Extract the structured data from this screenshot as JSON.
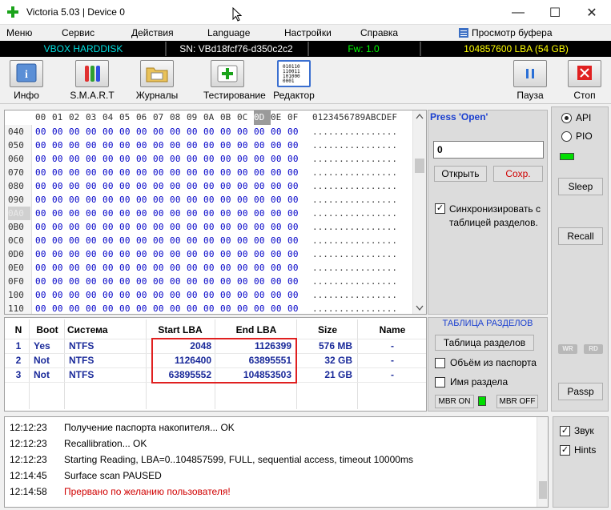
{
  "window": {
    "title": "Victoria 5.03 | Device 0",
    "minimize": "—",
    "maximize": "☐",
    "close": "✕"
  },
  "menu": {
    "items": [
      "Меню",
      "Сервис",
      "Действия",
      "Language",
      "Настройки",
      "Справка"
    ],
    "buffer_view": "Просмотр буфера"
  },
  "drive": {
    "model": "VBOX HARDDISK",
    "serial": "SN: VBd18fcf76-d350c2c2",
    "firmware": "Fw: 1.0",
    "capacity": "104857600 LBA (54 GB)",
    "colors": {
      "model": "#00e0e0",
      "serial": "#ffffff",
      "firmware": "#00ff00",
      "capacity": "#ffff00"
    }
  },
  "toolbar": {
    "info": "Инфо",
    "smart": "S.M.A.R.T",
    "logs": "Журналы",
    "testing": "Тестирование",
    "editor": "Редактор",
    "pause": "Пауза",
    "stop": "Стоп",
    "editor_icon_text": [
      "010110",
      "110011",
      "101000",
      "0001"
    ]
  },
  "hex": {
    "columns": [
      "00",
      "01",
      "02",
      "03",
      "04",
      "05",
      "06",
      "07",
      "08",
      "09",
      "0A",
      "0B",
      "0C",
      "0D",
      "0E",
      "0F"
    ],
    "selected_column": "0D",
    "ascii_header": "0123456789ABCDEF",
    "rows": [
      "040",
      "050",
      "060",
      "070",
      "080",
      "090",
      "0A0",
      "0B0",
      "0C0",
      "0D0",
      "0E0",
      "0F0",
      "100",
      "110"
    ],
    "selected_row": "0A0",
    "byte_value": "00",
    "ascii_value": "................"
  },
  "editor_panel": {
    "press_open": "Press 'Open'",
    "value": "0",
    "open": "Открыть",
    "save": "Сохр.",
    "sync_label": "Синхронизировать с таблицей разделов.",
    "sync_checked": true
  },
  "right_panel": {
    "api": "API",
    "pio": "PIO",
    "mode": "API",
    "sleep": "Sleep",
    "recall": "Recall",
    "wr": "WR",
    "rd": "RD",
    "passp": "Passp"
  },
  "partitions": {
    "headers": [
      "N",
      "Boot",
      "Система",
      "Start LBA",
      "End LBA",
      "Size",
      "Name"
    ],
    "rows": [
      {
        "n": "1",
        "boot": "Yes",
        "fs": "NTFS",
        "start": "2048",
        "end": "1126399",
        "size": "576 MB",
        "name": "-"
      },
      {
        "n": "2",
        "boot": "Not",
        "fs": "NTFS",
        "start": "1126400",
        "end": "63895551",
        "size": "32 GB",
        "name": "-"
      },
      {
        "n": "3",
        "boot": "Not",
        "fs": "NTFS",
        "start": "63895552",
        "end": "104853503",
        "size": "21 GB",
        "name": "-"
      }
    ]
  },
  "partition_panel": {
    "title": "ТАБЛИЦА РАЗДЕЛОВ",
    "button": "Таблица разделов",
    "volume_label": "Объём из паспорта",
    "name_label": "Имя раздела",
    "mbr_on": "MBR ON",
    "mbr_off": "MBR OFF"
  },
  "log": [
    {
      "time": "12:12:23",
      "msg": "Получение паспорта накопителя... OK",
      "color": "#000000"
    },
    {
      "time": "12:12:23",
      "msg": "Recallibration... OK",
      "color": "#000000"
    },
    {
      "time": "12:12:23",
      "msg": "Starting Reading, LBA=0..104857599, FULL, sequential access, timeout 10000ms",
      "color": "#000000"
    },
    {
      "time": "12:14:45",
      "msg": "Surface scan PAUSED",
      "color": "#000000"
    },
    {
      "time": "12:14:58",
      "msg": "Прервано по желанию пользователя!",
      "color": "#d00000"
    }
  ],
  "bottom_right": {
    "sound": "Звук",
    "hints": "Hints"
  }
}
